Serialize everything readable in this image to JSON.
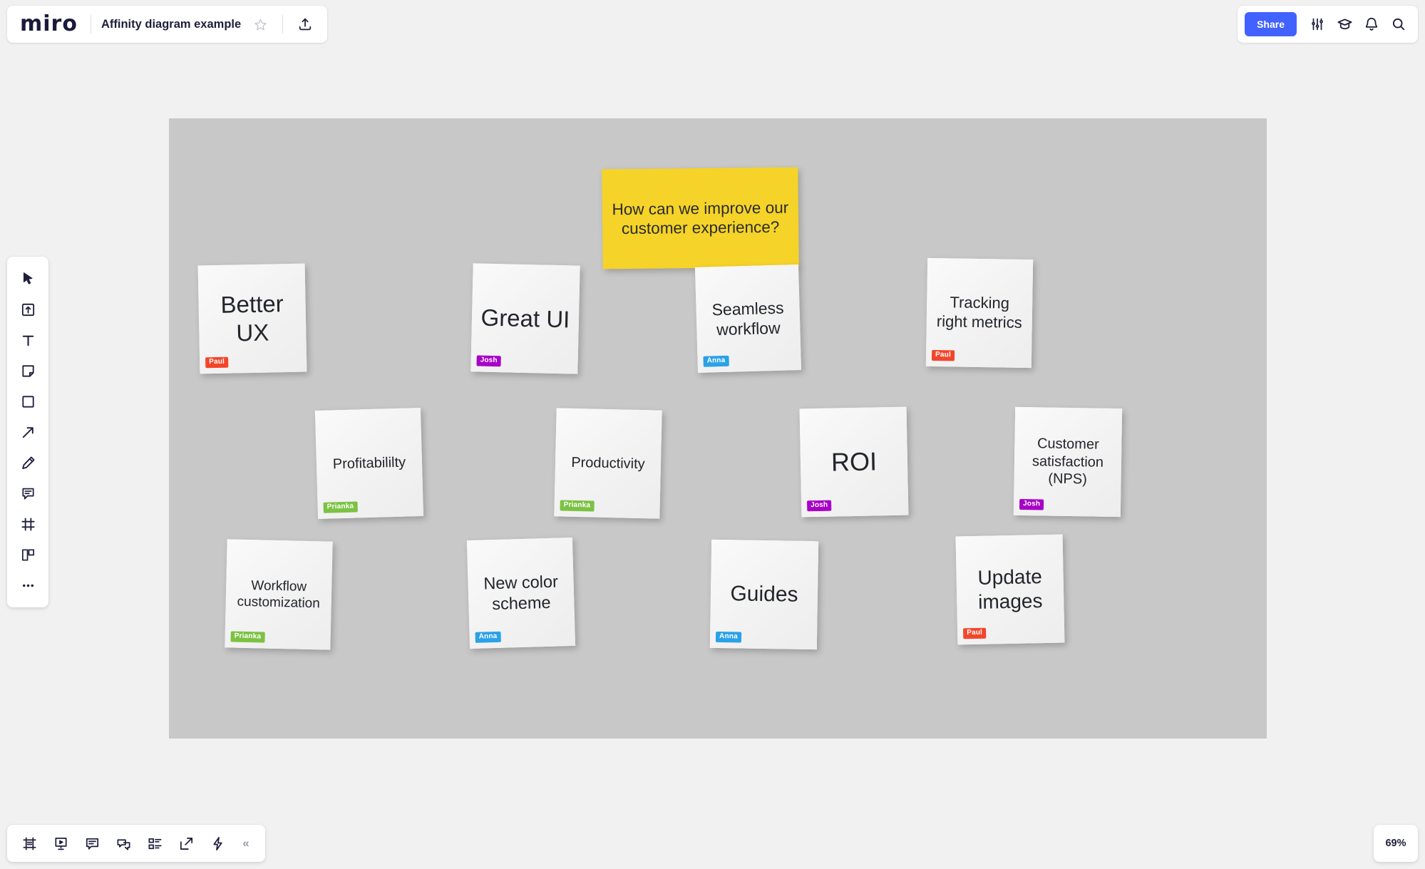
{
  "app": {
    "name": "miro",
    "logo_text": "miro",
    "zoom_level": "69%"
  },
  "header": {
    "title": "Affinity diagram example",
    "star_icon": "star-icon",
    "upload_icon": "upload-icon",
    "share_label": "Share",
    "right_icons": [
      {
        "name": "sliders-icon",
        "label": "Settings"
      },
      {
        "name": "graduation-cap-icon",
        "label": "Learning center"
      },
      {
        "name": "bell-icon",
        "label": "Notifications"
      },
      {
        "name": "search-icon",
        "label": "Search"
      }
    ]
  },
  "left_toolbar": {
    "items": [
      {
        "name": "cursor-select-icon",
        "label": "Select"
      },
      {
        "name": "upload-icon",
        "label": "Upload"
      },
      {
        "name": "text-icon",
        "label": "Text"
      },
      {
        "name": "sticky-note-icon",
        "label": "Sticky note"
      },
      {
        "name": "shape-square-icon",
        "label": "Shape"
      },
      {
        "name": "arrow-connector-icon",
        "label": "Connection line"
      },
      {
        "name": "pen-icon",
        "label": "Pen"
      },
      {
        "name": "comment-icon",
        "label": "Comment"
      },
      {
        "name": "frame-icon",
        "label": "Frame"
      },
      {
        "name": "templates-icon",
        "label": "Templates"
      },
      {
        "name": "more-icon",
        "label": "More apps"
      }
    ]
  },
  "bottom_toolbar": {
    "items": [
      {
        "name": "frames-panel-icon",
        "label": "Frames"
      },
      {
        "name": "presentation-icon",
        "label": "Presentation mode"
      },
      {
        "name": "comments-icon",
        "label": "Comments"
      },
      {
        "name": "chat-icon",
        "label": "Chat"
      },
      {
        "name": "cards-list-icon",
        "label": "Cards"
      },
      {
        "name": "export-icon",
        "label": "Export"
      },
      {
        "name": "lightning-icon",
        "label": "Apps"
      }
    ],
    "collapse_label": "«"
  },
  "board": {
    "question_note": {
      "text": "How can we improve our customer experience?",
      "color": "#f5d328"
    },
    "author_colors": {
      "Paul": "#f4452a",
      "Josh": "#a800c8",
      "Anna": "#2aa1e8",
      "Prianka": "#7cc242"
    },
    "notes": [
      {
        "text": "Better UX",
        "author": "Paul",
        "color": "#f4f4f4"
      },
      {
        "text": "Great UI",
        "author": "Josh",
        "color": "#f4f4f4"
      },
      {
        "text": "Seamless workflow",
        "author": "Anna",
        "color": "#f4f4f4"
      },
      {
        "text": "Tracking right metrics",
        "author": "Paul",
        "color": "#f4f4f4"
      },
      {
        "text": "Profitabililty",
        "author": "Prianka",
        "color": "#f4f4f4"
      },
      {
        "text": "Productivity",
        "author": "Prianka",
        "color": "#f4f4f4"
      },
      {
        "text": "ROI",
        "author": "Josh",
        "color": "#f4f4f4"
      },
      {
        "text": "Customer satisfaction (NPS)",
        "author": "Josh",
        "color": "#f4f4f4"
      },
      {
        "text": "Workflow customization",
        "author": "Prianka",
        "color": "#f4f4f4"
      },
      {
        "text": "New color scheme",
        "author": "Anna",
        "color": "#f4f4f4"
      },
      {
        "text": "Guides",
        "author": "Anna",
        "color": "#f4f4f4"
      },
      {
        "text": "Update images",
        "author": "Paul",
        "color": "#f4f4f4"
      }
    ]
  },
  "colors": {
    "accent": "#4262ff",
    "frame_bg": "#c8c8c8",
    "canvas_bg": "#f1f1f1",
    "ink": "#1e1e3c"
  }
}
